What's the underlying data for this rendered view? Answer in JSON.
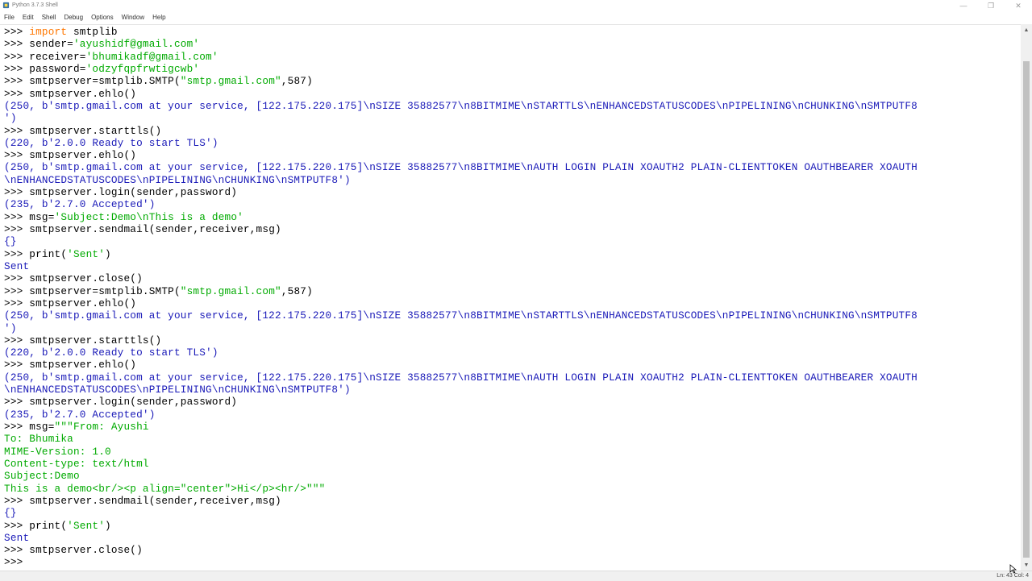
{
  "window": {
    "title": "Python 3.7.3 Shell",
    "controls": {
      "minimize": "—",
      "maximize": "❐",
      "close": "✕"
    }
  },
  "menu": [
    "File",
    "Edit",
    "Shell",
    "Debug",
    "Options",
    "Window",
    "Help"
  ],
  "shell_lines": [
    [
      {
        "t": ">>> ",
        "c": "prompt"
      },
      {
        "t": "import",
        "c": "kw"
      },
      {
        "t": " smtplib",
        "c": "code"
      }
    ],
    [
      {
        "t": ">>> ",
        "c": "prompt"
      },
      {
        "t": "sender=",
        "c": "code"
      },
      {
        "t": "'ayushidf@gmail.com'",
        "c": "str"
      }
    ],
    [
      {
        "t": ">>> ",
        "c": "prompt"
      },
      {
        "t": "receiver=",
        "c": "code"
      },
      {
        "t": "'bhumikadf@gmail.com'",
        "c": "str"
      }
    ],
    [
      {
        "t": ">>> ",
        "c": "prompt"
      },
      {
        "t": "password=",
        "c": "code"
      },
      {
        "t": "'odzyfqpfrwtigcwb'",
        "c": "str"
      }
    ],
    [
      {
        "t": ">>> ",
        "c": "prompt"
      },
      {
        "t": "smtpserver=smtplib.SMTP(",
        "c": "code"
      },
      {
        "t": "\"smtp.gmail.com\"",
        "c": "str"
      },
      {
        "t": ",587)",
        "c": "code"
      }
    ],
    [
      {
        "t": ">>> ",
        "c": "prompt"
      },
      {
        "t": "smtpserver.ehlo()",
        "c": "code"
      }
    ],
    [
      {
        "t": "(250, b'smtp.gmail.com at your service, [122.175.220.175]\\nSIZE 35882577\\n8BITMIME\\nSTARTTLS\\nENHANCEDSTATUSCODES\\nPIPELINING\\nCHUNKING\\nSMTPUTF8",
        "c": "out"
      }
    ],
    [
      {
        "t": "')",
        "c": "out"
      }
    ],
    [
      {
        "t": ">>> ",
        "c": "prompt"
      },
      {
        "t": "smtpserver.starttls()",
        "c": "code"
      }
    ],
    [
      {
        "t": "(220, b'2.0.0 Ready to start TLS')",
        "c": "out"
      }
    ],
    [
      {
        "t": ">>> ",
        "c": "prompt"
      },
      {
        "t": "smtpserver.ehlo()",
        "c": "code"
      }
    ],
    [
      {
        "t": "(250, b'smtp.gmail.com at your service, [122.175.220.175]\\nSIZE 35882577\\n8BITMIME\\nAUTH LOGIN PLAIN XOAUTH2 PLAIN-CLIENTTOKEN OAUTHBEARER XOAUTH",
        "c": "out"
      }
    ],
    [
      {
        "t": "\\nENHANCEDSTATUSCODES\\nPIPELINING\\nCHUNKING\\nSMTPUTF8')",
        "c": "out"
      }
    ],
    [
      {
        "t": ">>> ",
        "c": "prompt"
      },
      {
        "t": "smtpserver.login(sender,password)",
        "c": "code"
      }
    ],
    [
      {
        "t": "(235, b'2.7.0 Accepted')",
        "c": "out"
      }
    ],
    [
      {
        "t": ">>> ",
        "c": "prompt"
      },
      {
        "t": "msg=",
        "c": "code"
      },
      {
        "t": "'Subject:Demo\\nThis is a demo'",
        "c": "str"
      }
    ],
    [
      {
        "t": ">>> ",
        "c": "prompt"
      },
      {
        "t": "smtpserver.sendmail(sender,receiver,msg)",
        "c": "code"
      }
    ],
    [
      {
        "t": "{}",
        "c": "out"
      }
    ],
    [
      {
        "t": ">>> ",
        "c": "prompt"
      },
      {
        "t": "print(",
        "c": "code"
      },
      {
        "t": "'Sent'",
        "c": "str"
      },
      {
        "t": ")",
        "c": "code"
      }
    ],
    [
      {
        "t": "Sent",
        "c": "out"
      }
    ],
    [
      {
        "t": ">>> ",
        "c": "prompt"
      },
      {
        "t": "smtpserver.close()",
        "c": "code"
      }
    ],
    [
      {
        "t": ">>> ",
        "c": "prompt"
      },
      {
        "t": "smtpserver=smtplib.SMTP(",
        "c": "code"
      },
      {
        "t": "\"smtp.gmail.com\"",
        "c": "str"
      },
      {
        "t": ",587)",
        "c": "code"
      }
    ],
    [
      {
        "t": ">>> ",
        "c": "prompt"
      },
      {
        "t": "smtpserver.ehlo()",
        "c": "code"
      }
    ],
    [
      {
        "t": "(250, b'smtp.gmail.com at your service, [122.175.220.175]\\nSIZE 35882577\\n8BITMIME\\nSTARTTLS\\nENHANCEDSTATUSCODES\\nPIPELINING\\nCHUNKING\\nSMTPUTF8",
        "c": "out"
      }
    ],
    [
      {
        "t": "')",
        "c": "out"
      }
    ],
    [
      {
        "t": ">>> ",
        "c": "prompt"
      },
      {
        "t": "smtpserver.starttls()",
        "c": "code"
      }
    ],
    [
      {
        "t": "(220, b'2.0.0 Ready to start TLS')",
        "c": "out"
      }
    ],
    [
      {
        "t": ">>> ",
        "c": "prompt"
      },
      {
        "t": "smtpserver.ehlo()",
        "c": "code"
      }
    ],
    [
      {
        "t": "(250, b'smtp.gmail.com at your service, [122.175.220.175]\\nSIZE 35882577\\n8BITMIME\\nAUTH LOGIN PLAIN XOAUTH2 PLAIN-CLIENTTOKEN OAUTHBEARER XOAUTH",
        "c": "out"
      }
    ],
    [
      {
        "t": "\\nENHANCEDSTATUSCODES\\nPIPELINING\\nCHUNKING\\nSMTPUTF8')",
        "c": "out"
      }
    ],
    [
      {
        "t": ">>> ",
        "c": "prompt"
      },
      {
        "t": "smtpserver.login(sender,password)",
        "c": "code"
      }
    ],
    [
      {
        "t": "(235, b'2.7.0 Accepted')",
        "c": "out"
      }
    ],
    [
      {
        "t": ">>> ",
        "c": "prompt"
      },
      {
        "t": "msg=",
        "c": "code"
      },
      {
        "t": "\"\"\"From: Ayushi",
        "c": "str"
      }
    ],
    [
      {
        "t": "To: Bhumika",
        "c": "str"
      }
    ],
    [
      {
        "t": "MIME-Version: 1.0",
        "c": "str"
      }
    ],
    [
      {
        "t": "Content-type: text/html",
        "c": "str"
      }
    ],
    [
      {
        "t": "Subject:Demo",
        "c": "str"
      }
    ],
    [
      {
        "t": "This is a demo<br/><p align=\"center\">Hi</p><hr/>\"\"\"",
        "c": "str"
      }
    ],
    [
      {
        "t": ">>> ",
        "c": "prompt"
      },
      {
        "t": "smtpserver.sendmail(sender,receiver,msg)",
        "c": "code"
      }
    ],
    [
      {
        "t": "{}",
        "c": "out"
      }
    ],
    [
      {
        "t": ">>> ",
        "c": "prompt"
      },
      {
        "t": "print(",
        "c": "code"
      },
      {
        "t": "'Sent'",
        "c": "str"
      },
      {
        "t": ")",
        "c": "code"
      }
    ],
    [
      {
        "t": "Sent",
        "c": "out"
      }
    ],
    [
      {
        "t": ">>> ",
        "c": "prompt"
      },
      {
        "t": "smtpserver.close()",
        "c": "code"
      }
    ],
    [
      {
        "t": ">>> ",
        "c": "prompt"
      }
    ]
  ],
  "status": {
    "position": "Ln: 43   Col: 4"
  },
  "colors": {
    "prompt": "#000000",
    "keyword": "#ff7700",
    "string": "#00aa00",
    "output": "#1a1ab8"
  }
}
